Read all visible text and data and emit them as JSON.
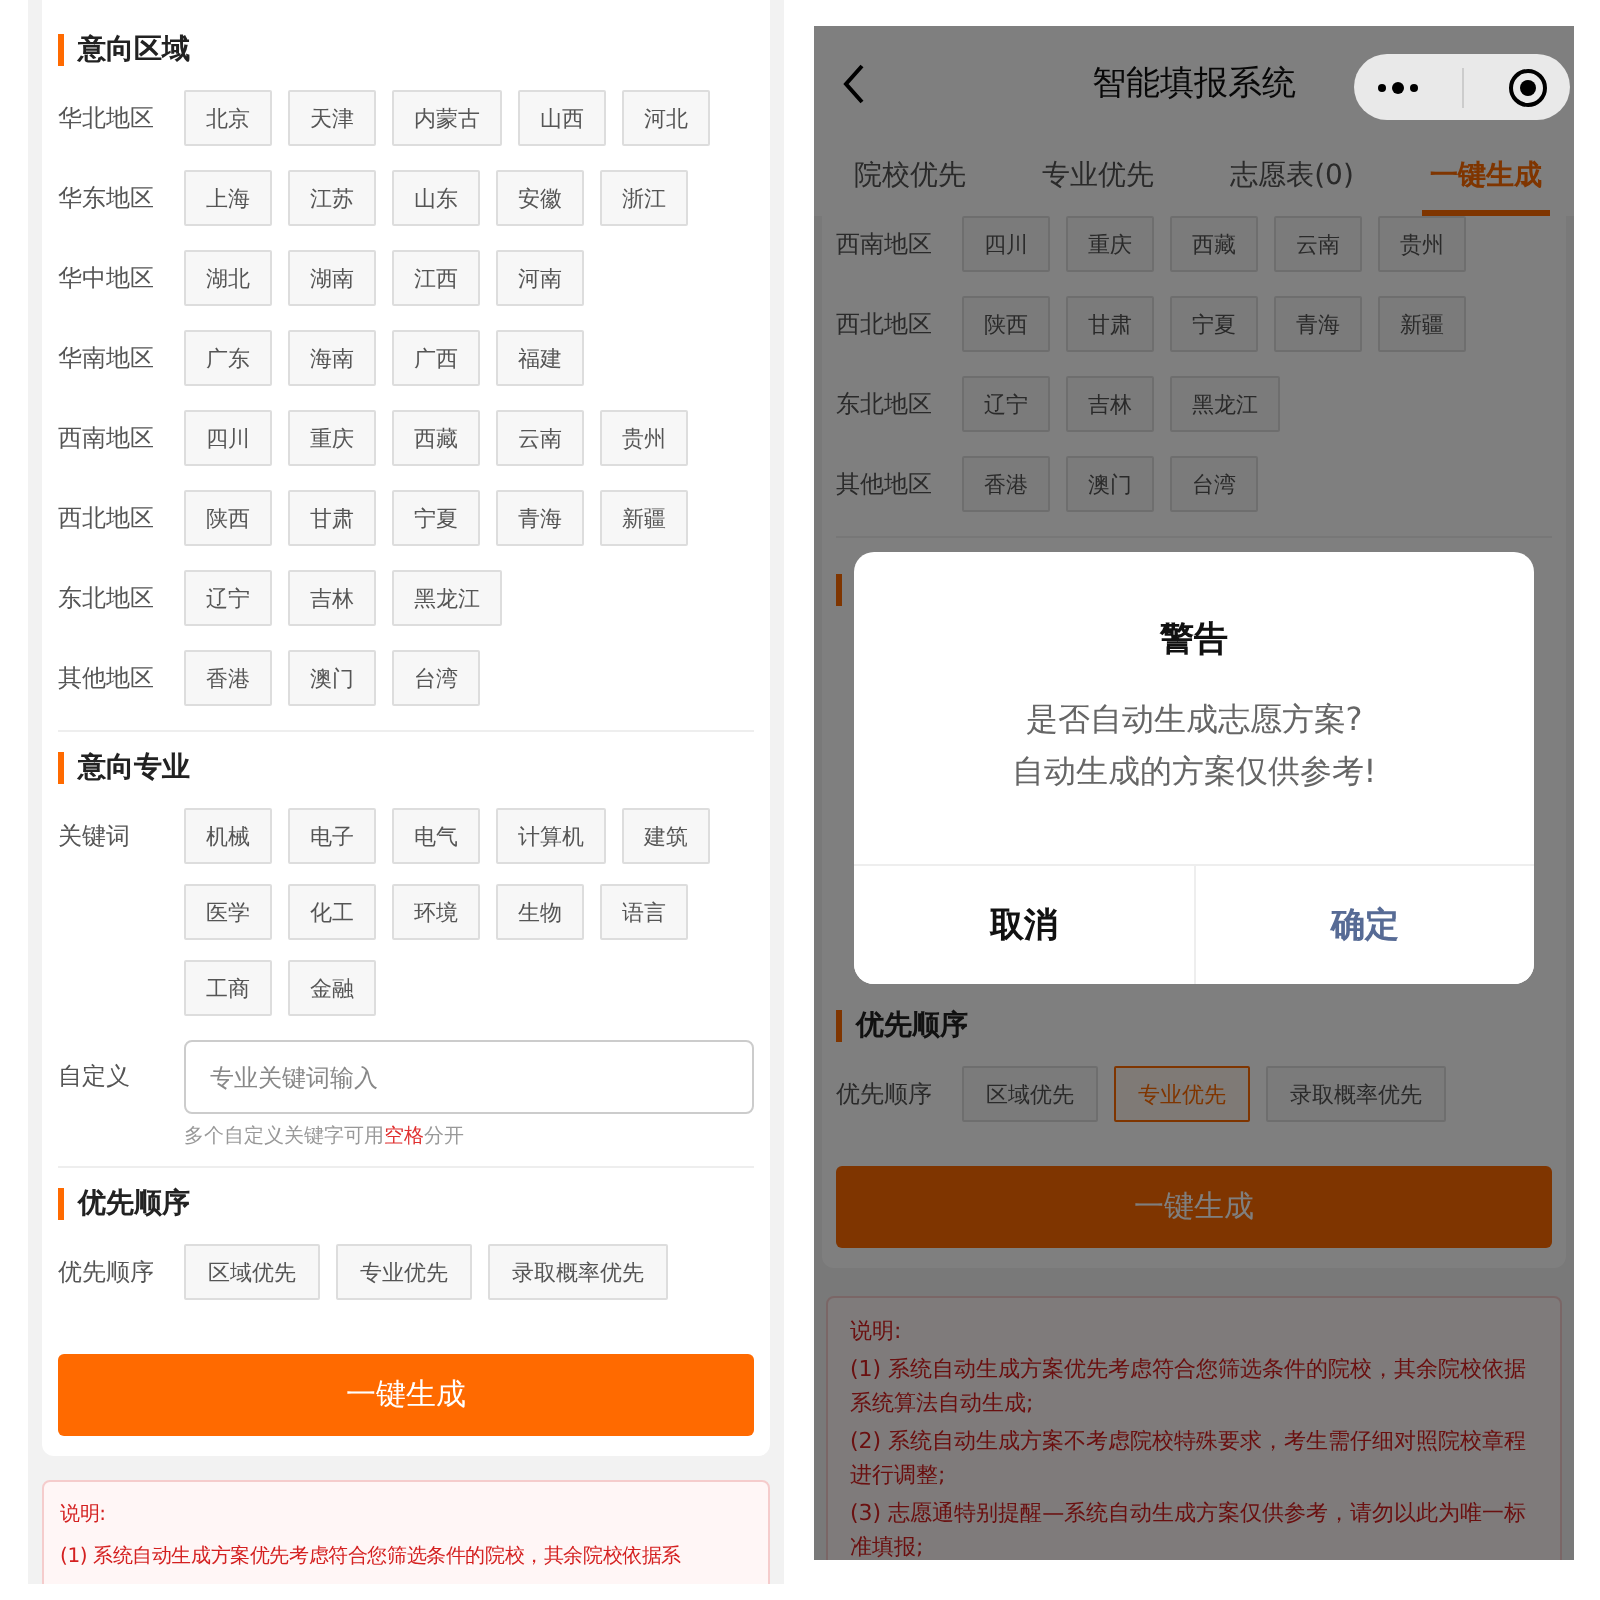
{
  "left_screen": {
    "region_section": {
      "title": "意向区域",
      "rows": [
        {
          "label": "华北地区",
          "tags": [
            "北京",
            "天津",
            "内蒙古",
            "山西",
            "河北"
          ]
        },
        {
          "label": "华东地区",
          "tags": [
            "上海",
            "江苏",
            "山东",
            "安徽",
            "浙江"
          ]
        },
        {
          "label": "华中地区",
          "tags": [
            "湖北",
            "湖南",
            "江西",
            "河南"
          ]
        },
        {
          "label": "华南地区",
          "tags": [
            "广东",
            "海南",
            "广西",
            "福建"
          ]
        },
        {
          "label": "西南地区",
          "tags": [
            "四川",
            "重庆",
            "西藏",
            "云南",
            "贵州"
          ]
        },
        {
          "label": "西北地区",
          "tags": [
            "陕西",
            "甘肃",
            "宁夏",
            "青海",
            "新疆"
          ]
        },
        {
          "label": "东北地区",
          "tags": [
            "辽宁",
            "吉林",
            "黑龙江"
          ]
        },
        {
          "label": "其他地区",
          "tags": [
            "香港",
            "澳门",
            "台湾"
          ]
        }
      ]
    },
    "major_section": {
      "title": "意向专业",
      "keyword_label": "关键词",
      "keywords": [
        "机械",
        "电子",
        "电气",
        "计算机",
        "建筑",
        "医学",
        "化工",
        "环境",
        "生物",
        "语言",
        "工商",
        "金融"
      ],
      "custom_label": "自定义",
      "custom_placeholder": "专业关键词输入",
      "hint": {
        "before": "多个自定义关键字可用",
        "highlight": "空格",
        "after": "分开"
      }
    },
    "priority_section": {
      "title": "优先顺序",
      "label": "优先顺序",
      "options": [
        {
          "label": "区域优先",
          "selected": false
        },
        {
          "label": "专业优先",
          "selected": false
        },
        {
          "label": "录取概率优先",
          "selected": false
        }
      ]
    },
    "generate_button": "一键生成",
    "notes": {
      "title": "说明:",
      "items": [
        "(1) 系统自动生成方案优先考虑符合您筛选条件的院校，其余院校依据系"
      ]
    }
  },
  "right_screen": {
    "nav": {
      "title": "智能填报系统"
    },
    "tabs": [
      {
        "label": "院校优先",
        "selected": false
      },
      {
        "label": "专业优先",
        "selected": false
      },
      {
        "label": "志愿表(0)",
        "selected": false
      },
      {
        "label": "一键生成",
        "selected": true
      }
    ],
    "region_rows": [
      {
        "label": "西南地区",
        "tags": [
          "四川",
          "重庆",
          "西藏",
          "云南",
          "贵州"
        ]
      },
      {
        "label": "西北地区",
        "tags": [
          "陕西",
          "甘肃",
          "宁夏",
          "青海",
          "新疆"
        ]
      },
      {
        "label": "东北地区",
        "tags": [
          "辽宁",
          "吉林",
          "黑龙江"
        ]
      },
      {
        "label": "其他地区",
        "tags": [
          "香港",
          "澳门",
          "台湾"
        ]
      }
    ],
    "priority_section": {
      "title": "优先顺序",
      "label": "优先顺序",
      "options": [
        {
          "label": "区域优先",
          "selected": false
        },
        {
          "label": "专业优先",
          "selected": true
        },
        {
          "label": "录取概率优先",
          "selected": false
        }
      ]
    },
    "generate_button": "一键生成",
    "notes": {
      "title": "说明:",
      "items": [
        "(1) 系统自动生成方案优先考虑符合您筛选条件的院校，其余院校依据系统算法自动生成;",
        "(2) 系统自动生成方案不考虑院校特殊要求，考生需仔细对照院校章程进行调整;",
        "(3) 志愿通特别提醒—系统自动生成方案仅供参考，请勿以此为唯一标准填报;"
      ]
    },
    "dialog": {
      "title": "警告",
      "lines": [
        "是否自动生成志愿方案?",
        "自动生成的方案仅供参考!"
      ],
      "cancel": "取消",
      "confirm": "确定"
    }
  }
}
